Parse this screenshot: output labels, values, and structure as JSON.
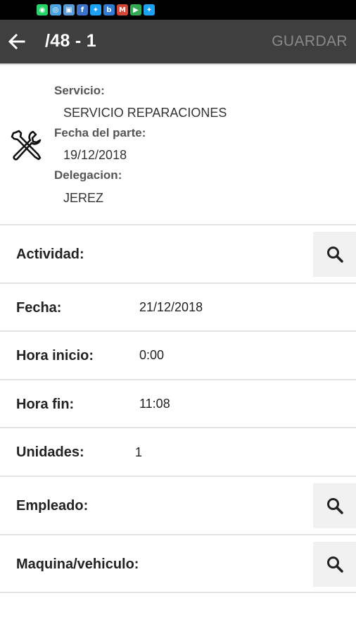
{
  "status_bar": {
    "notification_icons": [
      {
        "name": "whatsapp-icon",
        "glyph": "◉",
        "color": "#25d366"
      },
      {
        "name": "camera-icon",
        "glyph": "◎",
        "color": "#4aa3df"
      },
      {
        "name": "gallery-icon",
        "glyph": "▣",
        "color": "#5b9bd5"
      },
      {
        "name": "facebook-icon",
        "glyph": "f",
        "color": "#3b73c8"
      },
      {
        "name": "twitter-icon",
        "glyph": "✦",
        "color": "#1da1f2"
      },
      {
        "name": "app-b-icon",
        "glyph": "b",
        "color": "#2e7bcf"
      },
      {
        "name": "gmail-icon",
        "glyph": "M",
        "color": "#d44638"
      },
      {
        "name": "play-store-icon",
        "glyph": "▶",
        "color": "#34a853"
      },
      {
        "name": "twitter-icon-2",
        "glyph": "✦",
        "color": "#1da1f2"
      }
    ]
  },
  "appbar": {
    "title": "/48 - 1",
    "save_label": "GUARDAR"
  },
  "header": {
    "icon": "tools-icon",
    "servicio_label": "Servicio:",
    "servicio_value": "SERVICIO REPARACIONES",
    "fecha_parte_label": "Fecha del parte:",
    "fecha_parte_value": "19/12/2018",
    "delegacion_label": "Delegacion:",
    "delegacion_value": "JEREZ"
  },
  "form": {
    "actividad_label": "Actividad:",
    "fecha_label": "Fecha:",
    "fecha_value": "21/12/2018",
    "hora_inicio_label": "Hora inicio:",
    "hora_inicio_value": "0:00",
    "hora_fin_label": "Hora fin:",
    "hora_fin_value": "11:08",
    "unidades_label": "Unidades:",
    "unidades_value": "1",
    "empleado_label": "Empleado:",
    "maquina_label": "Maquina/vehiculo:"
  },
  "colors": {
    "appbar": "#3f3f3f",
    "save_disabled": "#8b8b8b",
    "search_button_bg": "#f1f1f1"
  }
}
